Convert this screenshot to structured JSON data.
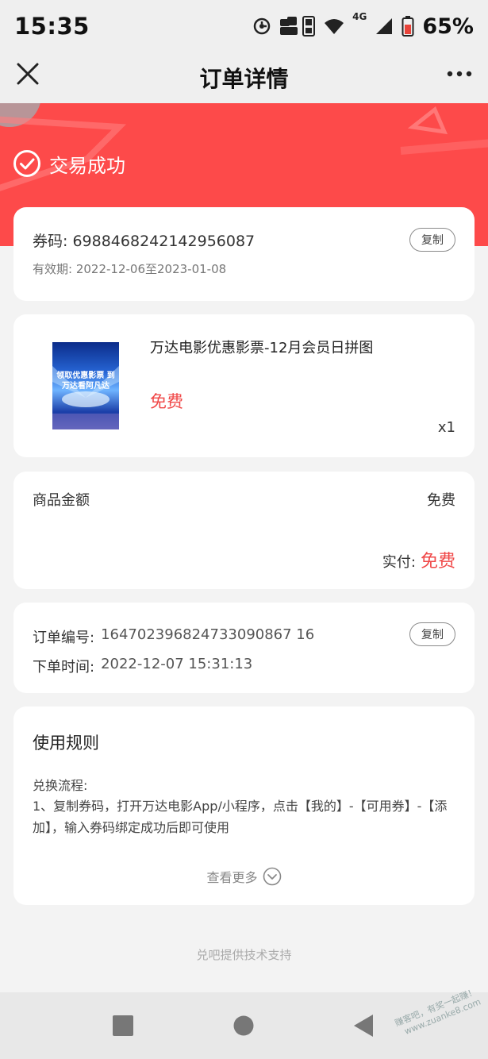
{
  "status_bar": {
    "time": "15:35",
    "network": "4G",
    "battery": "65%"
  },
  "header": {
    "title": "订单详情"
  },
  "banner": {
    "status_text": "交易成功",
    "color": "#fd4a4a"
  },
  "coupon": {
    "label": "券码: ",
    "code": "6988468242142956087",
    "validity": "有效期: 2022-12-06至2023-01-08",
    "copy_label": "复制"
  },
  "product": {
    "name": "万达电影优惠影票-12月会员日拼图",
    "price": "免费",
    "quantity": "x1",
    "thumbnail_text": "领取优惠影票 到万达看阿凡达"
  },
  "amount": {
    "goods_label": "商品金额",
    "goods_value": "免费",
    "paid_label": "实付:",
    "paid_value": "免费"
  },
  "order": {
    "number_label": "订单编号:",
    "number_value": "164702396824733090867 16",
    "time_label": "下单时间:",
    "time_value": "2022-12-07 15:31:13",
    "copy_label": "复制"
  },
  "rules": {
    "title": "使用规则",
    "subtitle": "兑换流程:",
    "text": "1、复制券码，打开万达电影App/小程序，点击【我的】-【可用券】-【添加】，输入券码绑定成功后即可使用",
    "see_more": "查看更多"
  },
  "footer": {
    "powered_by": "兑吧提供技术支持"
  },
  "watermark": {
    "line1": "赚客吧，有奖一起赚！",
    "line2": "www.zuanke8.com"
  },
  "colors": {
    "accent_red": "#f04848",
    "page_bg": "#f3f3f3"
  }
}
